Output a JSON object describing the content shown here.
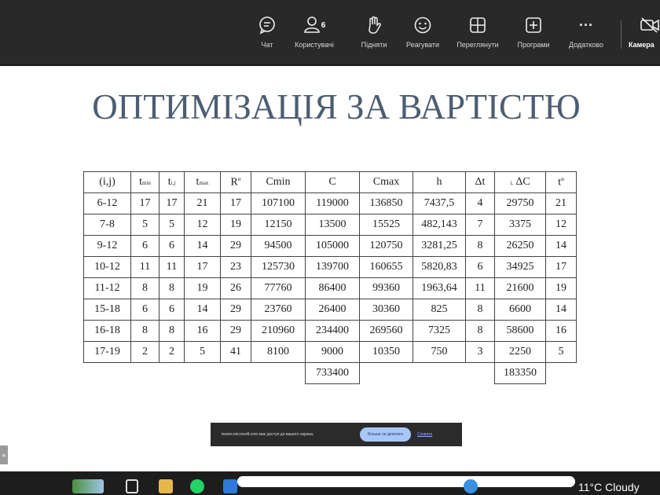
{
  "toolbar": {
    "items": [
      {
        "label": "Чат",
        "icon": "chat-icon"
      },
      {
        "label": "Користувачі",
        "icon": "people-icon",
        "count": "6"
      },
      {
        "label": "Підняти",
        "icon": "raise-hand-icon"
      },
      {
        "label": "Реагувати",
        "icon": "react-icon"
      },
      {
        "label": "Переглянути",
        "icon": "view-icon"
      },
      {
        "label": "Програми",
        "icon": "apps-icon"
      },
      {
        "label": "Додатково",
        "icon": "more-icon",
        "glyph": "···"
      },
      {
        "label": "Камера",
        "icon": "camera-icon"
      }
    ]
  },
  "slide": {
    "title": "ОПТИМІЗАЦІЯ ЗА ВАРТІСТЮ",
    "headers": {
      "ij": "(i,j)",
      "tmin": {
        "main": "t",
        "sub": "min"
      },
      "tij": {
        "main": "t",
        "sub": "i,j"
      },
      "tmax": {
        "main": "t",
        "sub": "max"
      },
      "R": {
        "main": "R",
        "sup": "н"
      },
      "cmin": "Cmin",
      "c": "C",
      "cmax": "Cmax",
      "h": "h",
      "dt": "Δt",
      "dc": {
        "pre": "i,",
        "main": " ΔC"
      },
      "tn": {
        "main": "t",
        "sup": "н"
      }
    },
    "rows": [
      [
        "6-12",
        "17",
        "17",
        "21",
        "17",
        "107100",
        "119000",
        "136850",
        "7437,5",
        "4",
        "29750",
        "21"
      ],
      [
        "7-8",
        "5",
        "5",
        "12",
        "19",
        "12150",
        "13500",
        "15525",
        "482,143",
        "7",
        "3375",
        "12"
      ],
      [
        "9-12",
        "6",
        "6",
        "14",
        "29",
        "94500",
        "105000",
        "120750",
        "3281,25",
        "8",
        "26250",
        "14"
      ],
      [
        "10-12",
        "11",
        "11",
        "17",
        "23",
        "125730",
        "139700",
        "160655",
        "5820,83",
        "6",
        "34925",
        "17"
      ],
      [
        "11-12",
        "8",
        "8",
        "19",
        "26",
        "77760",
        "86400",
        "99360",
        "1963,64",
        "11",
        "21600",
        "19"
      ],
      [
        "15-18",
        "6",
        "6",
        "14",
        "29",
        "23760",
        "26400",
        "30360",
        "825",
        "8",
        "6600",
        "14"
      ],
      [
        "16-18",
        "8",
        "8",
        "16",
        "29",
        "210960",
        "234400",
        "269560",
        "7325",
        "8",
        "58600",
        "16"
      ],
      [
        "17-19",
        "2",
        "2",
        "5",
        "41",
        "8100",
        "9000",
        "10350",
        "750",
        "3",
        "2250",
        "5"
      ]
    ],
    "totals": {
      "c": "733400",
      "dc": "183350"
    }
  },
  "share_notice": {
    "text": "teams.microsoft.com має доступ до вашого екрана.",
    "stop_label": "Більше не ділитися",
    "hide_label": "Сховати"
  },
  "side_tab": {
    "glyph": "«"
  },
  "taskbar": {
    "weather": "11°C  Cloudy"
  }
}
